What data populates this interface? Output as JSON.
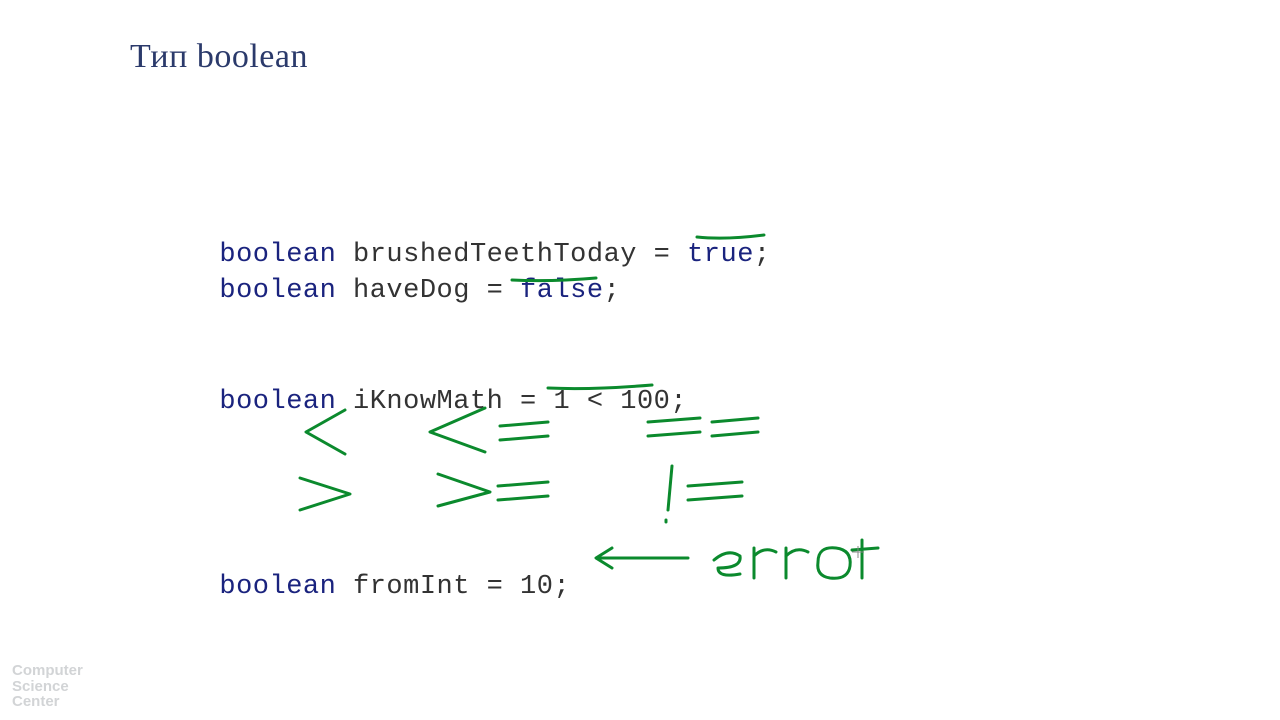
{
  "title": "Тип boolean",
  "code": {
    "line1": {
      "kw": "boolean",
      "ident": " brushedTeethToday = ",
      "val": "true",
      "tail": ";"
    },
    "line2": {
      "kw": "boolean",
      "ident": " haveDog = ",
      "val": "false",
      "tail": ";"
    },
    "line3": {
      "kw": "boolean",
      "ident": " iKnowMath = 1 < 100;"
    },
    "line4": {
      "kw": "boolean",
      "ident": " fromInt = 10;"
    }
  },
  "annotations": {
    "ops_row1": [
      "<",
      "<=",
      "=="
    ],
    "ops_row2": [
      ">",
      ">=",
      "!="
    ],
    "error_label": "error"
  },
  "watermark": {
    "l1": "Computer",
    "l2": "Science",
    "l3": "Center"
  }
}
